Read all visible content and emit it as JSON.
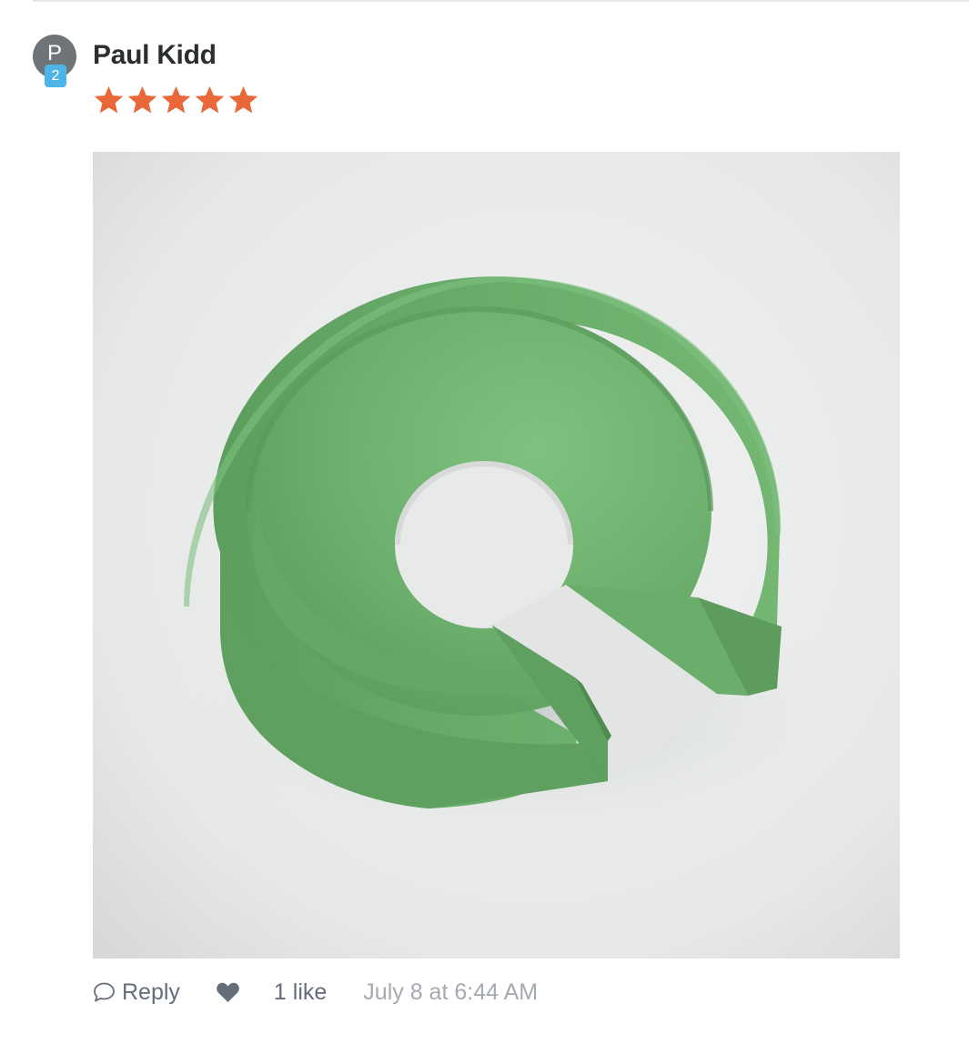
{
  "comment": {
    "avatar_letter": "P",
    "avatar_badge": "2",
    "author": "Paul Kidd",
    "rating": 5,
    "rating_max": 5,
    "star_color": "#e8683a",
    "photo_icon": "green-3d-printed-spiral-ring",
    "actions": {
      "reply_icon": "speech-bubble-icon",
      "reply_label": "Reply",
      "like_icon": "heart-icon",
      "like_count": "1 like",
      "timestamp": "July 8 at 6:44 AM"
    }
  }
}
